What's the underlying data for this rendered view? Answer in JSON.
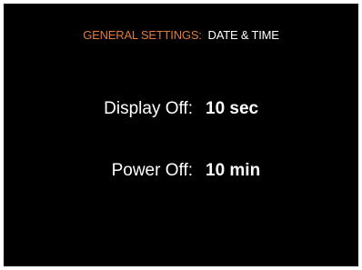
{
  "header": {
    "section": "GENERAL SETTINGS",
    "separator": ":",
    "page": "DATE & TIME"
  },
  "settings": [
    {
      "label": "Display Off:",
      "value": "10 sec"
    },
    {
      "label": "Power Off:",
      "value": "10 min"
    }
  ],
  "colors": {
    "background": "#000000",
    "accent": "#e07a3a",
    "text": "#ffffff"
  }
}
